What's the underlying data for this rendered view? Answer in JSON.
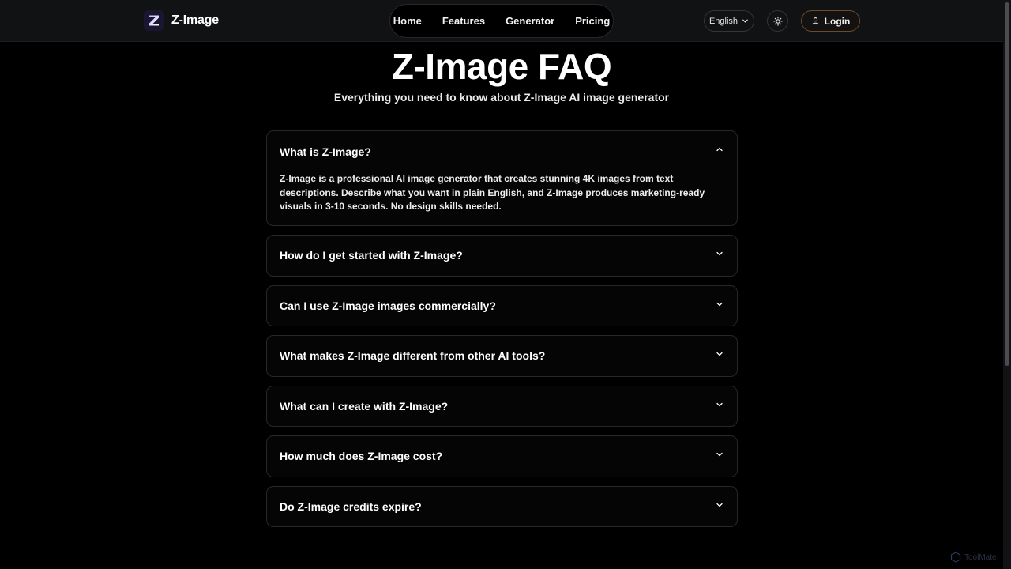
{
  "brand": {
    "name": "Z-Image",
    "logo_letter": "Z"
  },
  "nav": {
    "items": [
      "Home",
      "Features",
      "Generator",
      "Pricing"
    ]
  },
  "header": {
    "language": "English",
    "login_label": "Login"
  },
  "page": {
    "title": "Z-Image FAQ",
    "subtitle": "Everything you need to know about Z-Image AI image generator"
  },
  "faq": [
    {
      "question": "What is Z-Image?",
      "expanded": true,
      "answer": "Z-Image is a professional AI image generator that creates stunning 4K images from text descriptions. Describe what you want in plain English, and Z-Image produces marketing-ready visuals in 3-10 seconds. No design skills needed."
    },
    {
      "question": "How do I get started with Z-Image?",
      "expanded": false
    },
    {
      "question": "Can I use Z-Image images commercially?",
      "expanded": false
    },
    {
      "question": "What makes Z-Image different from other AI tools?",
      "expanded": false
    },
    {
      "question": "What can I create with Z-Image?",
      "expanded": false
    },
    {
      "question": "How much does Z-Image cost?",
      "expanded": false
    },
    {
      "question": "Do Z-Image credits expire?",
      "expanded": false
    }
  ],
  "watermark": {
    "text": "ToolMate"
  },
  "colors": {
    "background": "#000000",
    "login_border": "#6b4a2e",
    "logo_gradient_start": "#7b5cff",
    "logo_gradient_end": "#4f8bff"
  }
}
